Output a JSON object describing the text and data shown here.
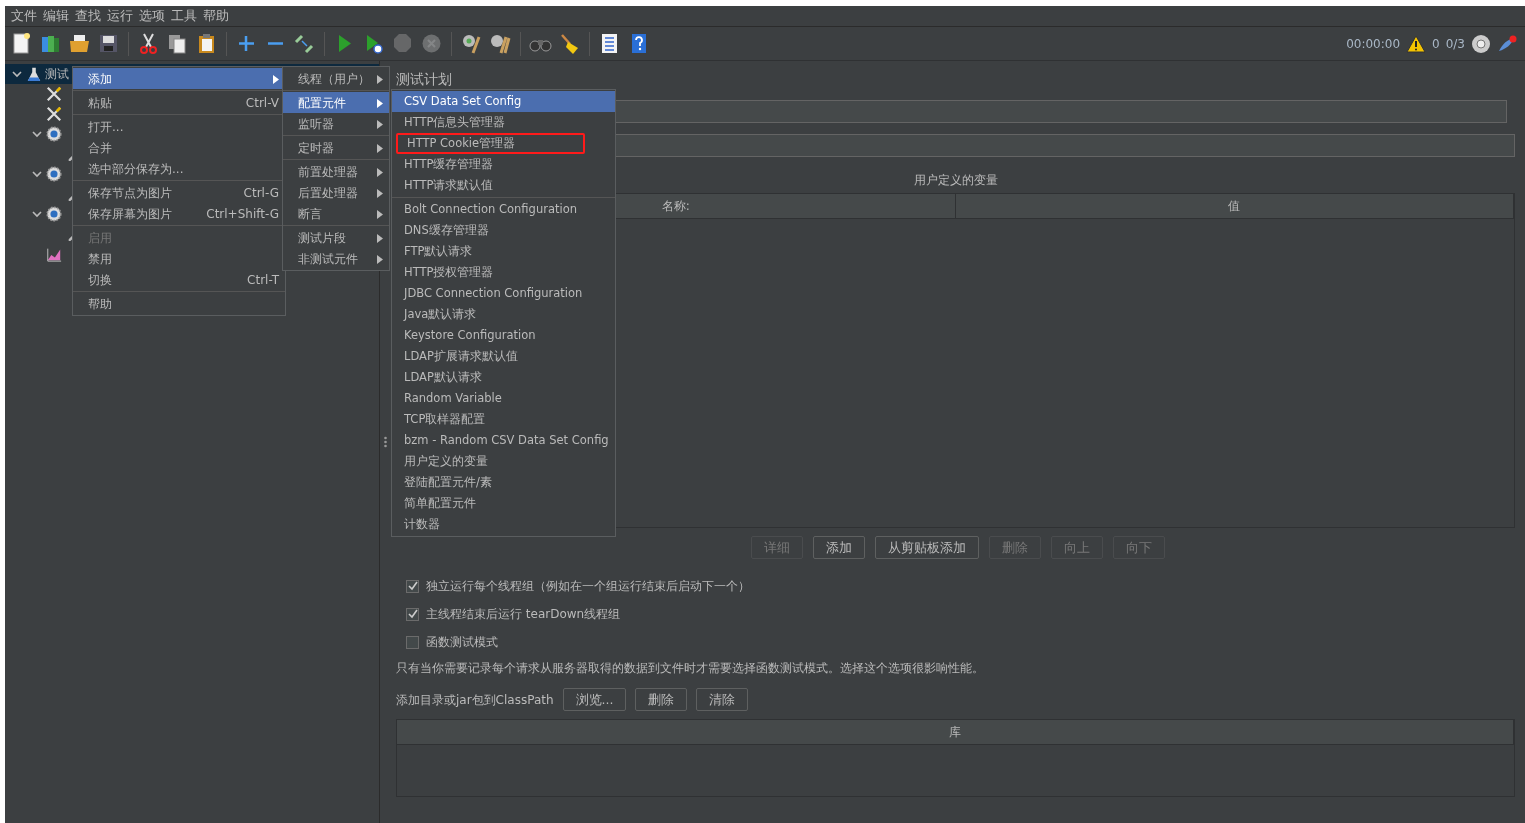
{
  "menu_bar": [
    "文件",
    "编辑",
    "查找",
    "运行",
    "选项",
    "工具",
    "帮助"
  ],
  "toolbar": [
    {
      "kind": "new",
      "disabled": false
    },
    {
      "kind": "templates",
      "disabled": false
    },
    {
      "kind": "open",
      "disabled": false
    },
    {
      "kind": "save",
      "disabled": false
    },
    {
      "kind": "sep"
    },
    {
      "kind": "cut",
      "disabled": false
    },
    {
      "kind": "copy",
      "disabled": false
    },
    {
      "kind": "paste",
      "disabled": false
    },
    {
      "kind": "sep"
    },
    {
      "kind": "expand",
      "disabled": false
    },
    {
      "kind": "collapse",
      "disabled": false
    },
    {
      "kind": "toggle",
      "disabled": false
    },
    {
      "kind": "sep"
    },
    {
      "kind": "start",
      "disabled": false
    },
    {
      "kind": "start_no_timers",
      "disabled": false
    },
    {
      "kind": "stop",
      "disabled": true
    },
    {
      "kind": "shutdown",
      "disabled": true
    },
    {
      "kind": "sep"
    },
    {
      "kind": "clear",
      "disabled": false
    },
    {
      "kind": "clear_all",
      "disabled": false
    },
    {
      "kind": "sep"
    },
    {
      "kind": "search",
      "disabled": false
    },
    {
      "kind": "reset_search",
      "disabled": false
    },
    {
      "kind": "sep"
    },
    {
      "kind": "functions",
      "disabled": false
    },
    {
      "kind": "help",
      "disabled": false
    }
  ],
  "status": {
    "timer": "00:00:00",
    "warnings": "0",
    "threads": "0/3"
  },
  "tree": [
    {
      "kind": "plan",
      "label": "测试",
      "selected": true,
      "expanded": true,
      "children": [
        {
          "kind": "config"
        },
        {
          "kind": "config"
        },
        {
          "kind": "thread_group",
          "expanded": true,
          "children": [
            {
              "kind": "sampler"
            }
          ]
        },
        {
          "kind": "thread_group",
          "expanded": true,
          "children": [
            {
              "kind": "sampler"
            }
          ]
        },
        {
          "kind": "thread_group",
          "expanded": true,
          "children": [
            {
              "kind": "sampler"
            }
          ]
        },
        {
          "kind": "listener"
        }
      ]
    }
  ],
  "context_menu": [
    {
      "kind": "item",
      "label": "添加",
      "selected": true,
      "disabled": false,
      "submenu": true
    },
    {
      "kind": "separator"
    },
    {
      "kind": "item",
      "label": "粘贴",
      "shortcut": "Ctrl-V",
      "selected": false,
      "disabled": false,
      "submenu": false
    },
    {
      "kind": "separator"
    },
    {
      "kind": "item",
      "label": "打开...",
      "selected": false,
      "disabled": false,
      "submenu": false
    },
    {
      "kind": "item",
      "label": "合并",
      "selected": false,
      "disabled": false,
      "submenu": false
    },
    {
      "kind": "item",
      "label": "选中部分保存为...",
      "selected": false,
      "disabled": false,
      "submenu": false
    },
    {
      "kind": "separator"
    },
    {
      "kind": "item",
      "label": "保存节点为图片",
      "shortcut": "Ctrl-G",
      "selected": false,
      "disabled": false,
      "submenu": false
    },
    {
      "kind": "item",
      "label": "保存屏幕为图片",
      "shortcut": "Ctrl+Shift-G",
      "selected": false,
      "disabled": false,
      "submenu": false
    },
    {
      "kind": "separator"
    },
    {
      "kind": "item",
      "label": "启用",
      "selected": false,
      "disabled": true,
      "submenu": false
    },
    {
      "kind": "item",
      "label": "禁用",
      "selected": false,
      "disabled": false,
      "submenu": false
    },
    {
      "kind": "item",
      "label": "切换",
      "shortcut": "Ctrl-T",
      "selected": false,
      "disabled": false,
      "submenu": false
    },
    {
      "kind": "separator"
    },
    {
      "kind": "item",
      "label": "帮助",
      "selected": false,
      "disabled": false,
      "submenu": false
    }
  ],
  "add_submenu": [
    {
      "kind": "item",
      "label": "线程（用户）",
      "selected": false,
      "submenu": true
    },
    {
      "kind": "separator"
    },
    {
      "kind": "item",
      "label": "配置元件",
      "selected": true,
      "submenu": true
    },
    {
      "kind": "item",
      "label": "监听器",
      "selected": false,
      "submenu": true
    },
    {
      "kind": "separator"
    },
    {
      "kind": "item",
      "label": "定时器",
      "selected": false,
      "submenu": true
    },
    {
      "kind": "separator"
    },
    {
      "kind": "item",
      "label": "前置处理器",
      "selected": false,
      "submenu": true
    },
    {
      "kind": "item",
      "label": "后置处理器",
      "selected": false,
      "submenu": true
    },
    {
      "kind": "item",
      "label": "断言",
      "selected": false,
      "submenu": true
    },
    {
      "kind": "separator"
    },
    {
      "kind": "item",
      "label": "测试片段",
      "selected": false,
      "submenu": true
    },
    {
      "kind": "item",
      "label": "非测试元件",
      "selected": false,
      "submenu": true
    }
  ],
  "config_submenu": [
    {
      "kind": "item",
      "label": "CSV Data Set Config",
      "selected": true,
      "highlighted": false
    },
    {
      "kind": "item",
      "label": "HTTP信息头管理器",
      "selected": false,
      "highlighted": false
    },
    {
      "kind": "item",
      "label": "HTTP Cookie管理器",
      "selected": false,
      "highlighted": true
    },
    {
      "kind": "item",
      "label": "HTTP缓存管理器",
      "selected": false,
      "highlighted": false
    },
    {
      "kind": "item",
      "label": "HTTP请求默认值",
      "selected": false,
      "highlighted": false
    },
    {
      "kind": "separator"
    },
    {
      "kind": "item",
      "label": "Bolt Connection Configuration",
      "selected": false,
      "highlighted": false
    },
    {
      "kind": "item",
      "label": "DNS缓存管理器",
      "selected": false,
      "highlighted": false
    },
    {
      "kind": "item",
      "label": "FTP默认请求",
      "selected": false,
      "highlighted": false
    },
    {
      "kind": "item",
      "label": "HTTP授权管理器",
      "selected": false,
      "highlighted": false
    },
    {
      "kind": "item",
      "label": "JDBC Connection Configuration",
      "selected": false,
      "highlighted": false
    },
    {
      "kind": "item",
      "label": "Java默认请求",
      "selected": false,
      "highlighted": false
    },
    {
      "kind": "item",
      "label": "Keystore Configuration",
      "selected": false,
      "highlighted": false
    },
    {
      "kind": "item",
      "label": "LDAP扩展请求默认值",
      "selected": false,
      "highlighted": false
    },
    {
      "kind": "item",
      "label": "LDAP默认请求",
      "selected": false,
      "highlighted": false
    },
    {
      "kind": "item",
      "label": "Random Variable",
      "selected": false,
      "highlighted": false
    },
    {
      "kind": "item",
      "label": "TCP取样器配置",
      "selected": false,
      "highlighted": false
    },
    {
      "kind": "item",
      "label": "bzm - Random CSV Data Set Config",
      "selected": false,
      "highlighted": false
    },
    {
      "kind": "item",
      "label": "用户定义的变量",
      "selected": false,
      "highlighted": false
    },
    {
      "kind": "item",
      "label": "登陆配置元件/素",
      "selected": false,
      "highlighted": false
    },
    {
      "kind": "item",
      "label": "简单配置元件",
      "selected": false,
      "highlighted": false
    },
    {
      "kind": "item",
      "label": "计数器",
      "selected": false,
      "highlighted": false
    }
  ],
  "test_plan": {
    "title": "测试计划",
    "variables": {
      "title": "用户定义的变量",
      "columns": [
        "名称:",
        "值"
      ]
    },
    "variable_buttons": [
      {
        "label": "详细",
        "disabled": true
      },
      {
        "label": "添加",
        "disabled": false
      },
      {
        "label": "从剪贴板添加",
        "disabled": false
      },
      {
        "label": "删除",
        "disabled": true
      },
      {
        "label": "向上",
        "disabled": true
      },
      {
        "label": "向下",
        "disabled": true
      }
    ],
    "options": [
      {
        "label": "独立运行每个线程组（例如在一个组运行结束后启动下一个）",
        "checked": true
      },
      {
        "label": "主线程结束后运行 tearDown线程组",
        "checked": true
      },
      {
        "label": "函数测试模式",
        "checked": false
      }
    ],
    "note": "只有当你需要记录每个请求从服务器取得的数据到文件时才需要选择函数测试模式。选择这个选项很影响性能。",
    "classpath": {
      "label": "添加目录或jar包到ClassPath",
      "buttons": [
        "浏览...",
        "删除",
        "清除"
      ],
      "column": "库"
    }
  }
}
